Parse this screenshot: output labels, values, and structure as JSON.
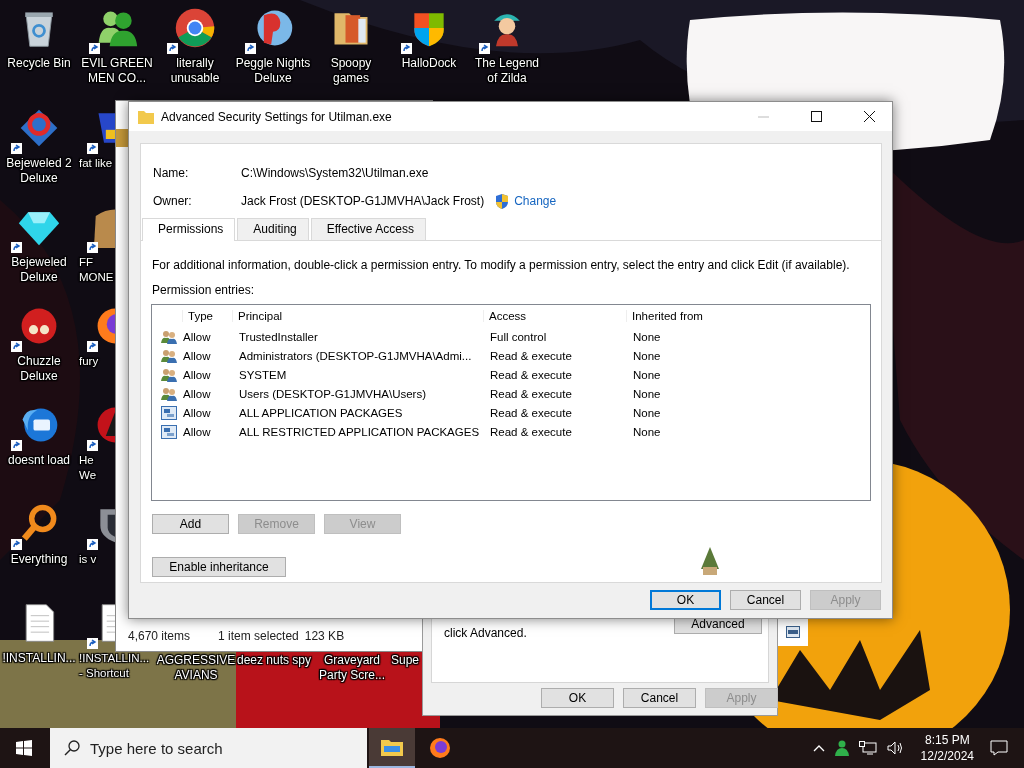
{
  "desktop": {
    "top_row": [
      {
        "label": "Recycle Bin",
        "shortcut": false
      },
      {
        "label": "EVIL GREEN\nMEN CO...",
        "shortcut": true
      },
      {
        "label": "literally\nunusable",
        "shortcut": true
      },
      {
        "label": "Peggle Nights\nDeluxe",
        "shortcut": true
      },
      {
        "label": "Spoopy\ngames",
        "shortcut": false
      },
      {
        "label": "HalloDock",
        "shortcut": true
      },
      {
        "label": "The Legend\nof Zilda",
        "shortcut": true
      }
    ],
    "first_column": [
      {
        "label": "Bejeweled 2\nDeluxe",
        "shortcut": true
      },
      {
        "label": "Bejeweled\nDeluxe",
        "shortcut": true
      },
      {
        "label": "Chuzzle\nDeluxe",
        "shortcut": true
      },
      {
        "label": "doesnt load",
        "shortcut": true
      },
      {
        "label": "Everything",
        "shortcut": true
      },
      {
        "label": "!INSTALLIN...",
        "shortcut": false
      }
    ],
    "second_column": [
      {
        "label": "fat like",
        "shortcut": true
      },
      {
        "label": "FF\nMONE",
        "shortcut": true
      },
      {
        "label": "fury",
        "shortcut": true
      },
      {
        "label": "He\nWe",
        "shortcut": true
      },
      {
        "label": "is v",
        "shortcut": true
      },
      {
        "label": "!INSTALLIN...\n- Shortcut",
        "shortcut": true
      }
    ],
    "bottom_row": [
      {
        "label": "AGGRESSIVE\nAVIANS"
      },
      {
        "label": "deez nuts spy"
      },
      {
        "label": "Graveyard\nParty Scre..."
      },
      {
        "label": "Supe"
      }
    ]
  },
  "explorer_window": {
    "item_count": "4,670 items",
    "selection": "1 item selected",
    "size": "123 KB"
  },
  "properties_dialog": {
    "note": "click Advanced.",
    "advanced_button": "Advanced",
    "buttons": [
      {
        "label": "OK",
        "disabled": false
      },
      {
        "label": "Cancel",
        "disabled": false
      },
      {
        "label": "Apply",
        "disabled": true
      }
    ]
  },
  "dialog": {
    "title": "Advanced Security Settings for Utilman.exe",
    "name_label": "Name:",
    "name_value": "C:\\Windows\\System32\\Utilman.exe",
    "owner_label": "Owner:",
    "owner_value": "Jack Frost (DESKTOP-G1JMVHA\\Jack Frost)",
    "change_link": "Change",
    "tabs": [
      {
        "label": "Permissions",
        "selected": true
      },
      {
        "label": "Auditing",
        "selected": false
      },
      {
        "label": "Effective Access",
        "selected": false
      }
    ],
    "info": "For additional information, double-click a permission entry. To modify a permission entry, select the entry and click Edit (if available).",
    "entries_label": "Permission entries:",
    "columns": [
      "Type",
      "Principal",
      "Access",
      "Inherited from"
    ],
    "rows": [
      {
        "kind": "group",
        "type": "Allow",
        "principal": "TrustedInstaller",
        "access": "Full control",
        "inherited_from": "None"
      },
      {
        "kind": "group",
        "type": "Allow",
        "principal": "Administrators (DESKTOP-G1JMVHA\\Admi...",
        "access": "Read & execute",
        "inherited_from": "None"
      },
      {
        "kind": "group",
        "type": "Allow",
        "principal": "SYSTEM",
        "access": "Read & execute",
        "inherited_from": "None"
      },
      {
        "kind": "group",
        "type": "Allow",
        "principal": "Users (DESKTOP-G1JMVHA\\Users)",
        "access": "Read & execute",
        "inherited_from": "None"
      },
      {
        "kind": "package",
        "type": "Allow",
        "principal": "ALL APPLICATION PACKAGES",
        "access": "Read & execute",
        "inherited_from": "None"
      },
      {
        "kind": "package",
        "type": "Allow",
        "principal": "ALL RESTRICTED APPLICATION PACKAGES",
        "access": "Read & execute",
        "inherited_from": "None"
      }
    ],
    "entry_buttons": [
      {
        "label": "Add",
        "disabled": false
      },
      {
        "label": "Remove",
        "disabled": true
      },
      {
        "label": "View",
        "disabled": true
      }
    ],
    "inheritance_button": "Enable inheritance",
    "buttons": [
      {
        "label": "OK",
        "default": true,
        "disabled": false
      },
      {
        "label": "Cancel",
        "default": false,
        "disabled": false
      },
      {
        "label": "Apply",
        "default": false,
        "disabled": true
      }
    ]
  },
  "taskbar": {
    "search_placeholder": "Type here to search",
    "apps": [
      {
        "selected": true
      },
      {
        "selected": false
      }
    ],
    "time": "8:15 PM",
    "date": "12/2/2024"
  }
}
